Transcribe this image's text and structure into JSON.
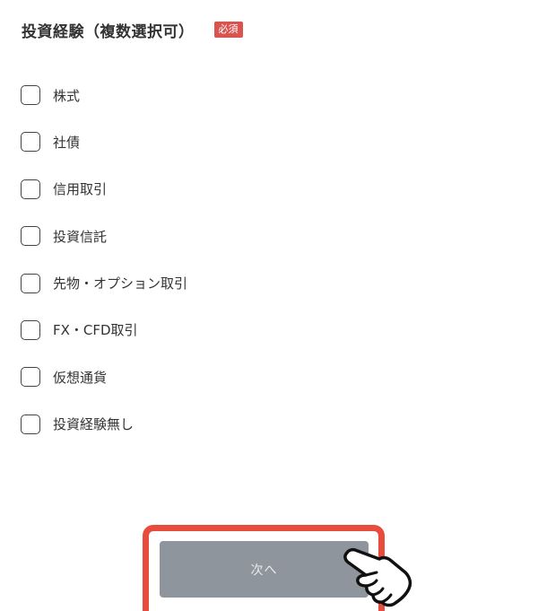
{
  "header": {
    "title": "投資経験（複数選択可）",
    "required_badge": "必須"
  },
  "options": [
    {
      "label": "株式",
      "checked": false
    },
    {
      "label": "社債",
      "checked": false
    },
    {
      "label": "信用取引",
      "checked": false
    },
    {
      "label": "投資信託",
      "checked": false
    },
    {
      "label": "先物・オプション取引",
      "checked": false
    },
    {
      "label": "FX・CFD取引",
      "checked": false
    },
    {
      "label": "仮想通貨",
      "checked": false
    },
    {
      "label": "投資経験無し",
      "checked": false
    }
  ],
  "next_button": {
    "label": "次へ"
  },
  "colors": {
    "badge": "#d9534f",
    "button": "#8f959c",
    "highlight": "#e84c3d"
  },
  "icons": {
    "pointer": "pointing-hand-icon"
  }
}
